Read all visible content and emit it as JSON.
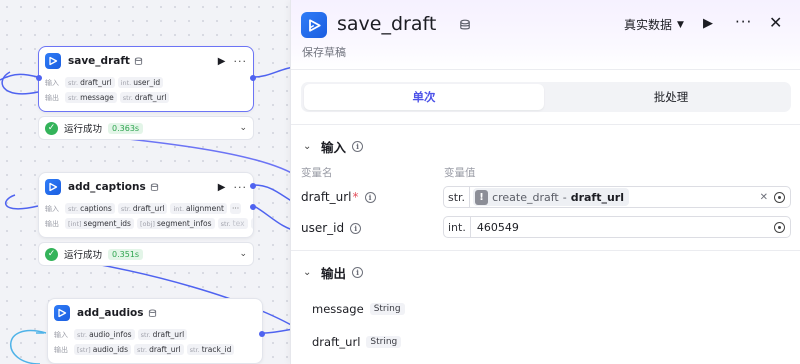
{
  "canvas": {
    "nodes": [
      {
        "title": "save_draft",
        "inputs_label": "输入",
        "outputs_label": "输出",
        "inputs": [
          {
            "type": "str.",
            "name": "draft_url"
          },
          {
            "type": "int.",
            "name": "user_id"
          }
        ],
        "outputs": [
          {
            "type": "str.",
            "name": "message"
          },
          {
            "type": "str.",
            "name": "draft_url"
          }
        ]
      },
      {
        "title": "add_captions",
        "inputs_label": "输入",
        "outputs_label": "输出",
        "inputs": [
          {
            "type": "str.",
            "name": "captions"
          },
          {
            "type": "str.",
            "name": "draft_url"
          },
          {
            "type": "int.",
            "name": "alignment"
          }
        ],
        "outputs": [
          {
            "type": "[int]",
            "name": "segment_ids"
          },
          {
            "type": "[obj]",
            "name": "segment_infos"
          },
          {
            "type": "str.",
            "name": "tex"
          }
        ]
      },
      {
        "title": "add_audios",
        "inputs_label": "输入",
        "outputs_label": "输出",
        "inputs": [
          {
            "type": "str.",
            "name": "audio_infos"
          },
          {
            "type": "str.",
            "name": "draft_url"
          }
        ],
        "outputs": [
          {
            "type": "[str]",
            "name": "audio_ids"
          },
          {
            "type": "str.",
            "name": "draft_url"
          },
          {
            "type": "str.",
            "name": "track_id"
          }
        ]
      }
    ],
    "statuses": [
      {
        "text": "运行成功",
        "time": "0.363s"
      },
      {
        "text": "运行成功",
        "time": "0.351s"
      }
    ],
    "more_glyph": "···"
  },
  "panel": {
    "title": "save_draft",
    "description": "保存草稿",
    "data_mode": "真实数据",
    "tabs": {
      "single": "单次",
      "batch": "批处理"
    },
    "input_section": {
      "label": "输入",
      "col_name": "变量名",
      "col_value": "变量值",
      "params": [
        {
          "name": "draft_url",
          "required": "*",
          "type": "str.",
          "ref_node": "create_draft",
          "ref_sep": "-",
          "ref_var": "draft_url",
          "warn": "!"
        },
        {
          "name": "user_id",
          "type": "int.",
          "value": "460549"
        }
      ]
    },
    "output_section": {
      "label": "输出",
      "params": [
        {
          "name": "message",
          "type": "String"
        },
        {
          "name": "draft_url",
          "type": "String"
        }
      ]
    }
  },
  "colors": {
    "accent": "#4d53e8",
    "wire": "#4f63f0",
    "success": "#34b35a",
    "node_logo": "#2f7cf7"
  },
  "icons": [
    "play-icon",
    "more-icon",
    "close-icon",
    "database-icon",
    "info-icon",
    "chevron-down-icon",
    "check-circle-icon",
    "target-icon",
    "warning-icon",
    "clear-icon"
  ]
}
